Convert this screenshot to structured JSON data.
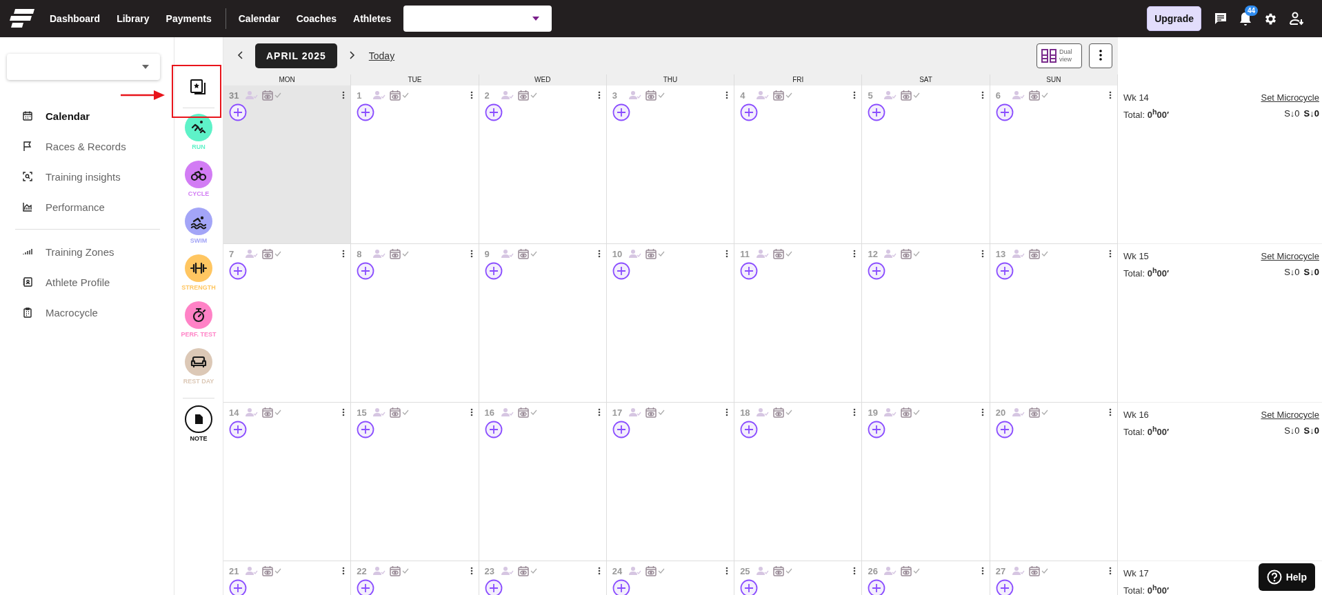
{
  "topbar": {
    "links_left": [
      "Dashboard",
      "Library",
      "Payments"
    ],
    "links_right": [
      "Calendar",
      "Coaches",
      "Athletes"
    ],
    "upgrade": "Upgrade",
    "notification_count": "44"
  },
  "sidebar": {
    "groups": [
      [
        {
          "label": "Calendar",
          "kind": "calendar",
          "selected": true
        },
        {
          "label": "Races & Records",
          "kind": "flag",
          "selected": false
        },
        {
          "label": "Training insights",
          "kind": "scan",
          "selected": false
        },
        {
          "label": "Performance",
          "kind": "chart",
          "selected": false
        }
      ],
      [
        {
          "label": "Training Zones",
          "kind": "zones",
          "selected": false
        },
        {
          "label": "Athlete Profile",
          "kind": "profile",
          "selected": false
        },
        {
          "label": "Macrocycle",
          "kind": "clipboard",
          "selected": false
        }
      ]
    ]
  },
  "activities": [
    {
      "label": "RUN",
      "kind": "run",
      "color": "#5ef2c8"
    },
    {
      "label": "CYCLE",
      "kind": "cycle",
      "color": "#d27cf4"
    },
    {
      "label": "SWIM",
      "kind": "swim",
      "color": "#a3a5f7"
    },
    {
      "label": "STRENGTH",
      "kind": "strength",
      "color": "#ffc661"
    },
    {
      "label": "PERF. TEST",
      "kind": "test",
      "color": "#ff82c6"
    },
    {
      "label": "REST DAY",
      "kind": "rest",
      "color": "#dcc8b6"
    },
    {
      "label": "NOTE",
      "kind": "note"
    }
  ],
  "calendar": {
    "month": "APRIL 2025",
    "today": "Today",
    "dual_view": "Dual view",
    "weekdays": [
      "MON",
      "TUE",
      "WED",
      "THU",
      "FRI",
      "SAT",
      "SUN"
    ],
    "weeks": [
      {
        "week": "Wk 14",
        "set_microcycle": "Set Microcycle",
        "total": "Total: **0$^{h}$00′**",
        "stress": [
          {
            "text": "S↓0",
            "kind": "planned"
          },
          {
            "text": "S↓0",
            "kind": "completed"
          }
        ],
        "days": [
          {
            "number": "31",
            "outside_month": true
          },
          {
            "number": "1",
            "outside_month": false
          },
          {
            "number": "2",
            "outside_month": false
          },
          {
            "number": "3",
            "outside_month": false
          },
          {
            "number": "4",
            "outside_month": false
          },
          {
            "number": "5",
            "outside_month": false
          },
          {
            "number": "6",
            "outside_month": false
          }
        ]
      },
      {
        "week": "Wk 15",
        "set_microcycle": "Set Microcycle",
        "total": "Total: **0$^{h}$00′**",
        "stress": [
          {
            "text": "S↓0",
            "kind": "planned"
          },
          {
            "text": "S↓0",
            "kind": "completed"
          }
        ],
        "days": [
          {
            "number": "7",
            "outside_month": false
          },
          {
            "number": "8",
            "outside_month": false
          },
          {
            "number": "9",
            "outside_month": false
          },
          {
            "number": "10",
            "outside_month": false
          },
          {
            "number": "11",
            "outside_month": false
          },
          {
            "number": "12",
            "outside_month": false
          },
          {
            "number": "13",
            "outside_month": false
          }
        ]
      },
      {
        "week": "Wk 16",
        "set_microcycle": "Set Microcycle",
        "total": "Total: **0$^{h}$00′**",
        "stress": [
          {
            "text": "S↓0",
            "kind": "planned"
          },
          {
            "text": "S↓0",
            "kind": "completed"
          }
        ],
        "days": [
          {
            "number": "14",
            "outside_month": false
          },
          {
            "number": "15",
            "outside_month": false
          },
          {
            "number": "16",
            "outside_month": false
          },
          {
            "number": "17",
            "outside_month": false
          },
          {
            "number": "18",
            "outside_month": false
          },
          {
            "number": "19",
            "outside_month": false
          },
          {
            "number": "20",
            "outside_month": false
          }
        ]
      },
      {
        "week": "Wk 17",
        "total": "Total: **0$^{h}$00′**",
        "days": [
          {
            "number": "21",
            "outside_month": false
          },
          {
            "number": "22",
            "outside_month": false
          },
          {
            "number": "23",
            "outside_month": false
          },
          {
            "number": "24",
            "outside_month": false
          },
          {
            "number": "25",
            "outside_month": false
          },
          {
            "number": "26",
            "outside_month": false
          },
          {
            "number": "27",
            "outside_month": false
          }
        ]
      }
    ]
  },
  "help": "Help"
}
